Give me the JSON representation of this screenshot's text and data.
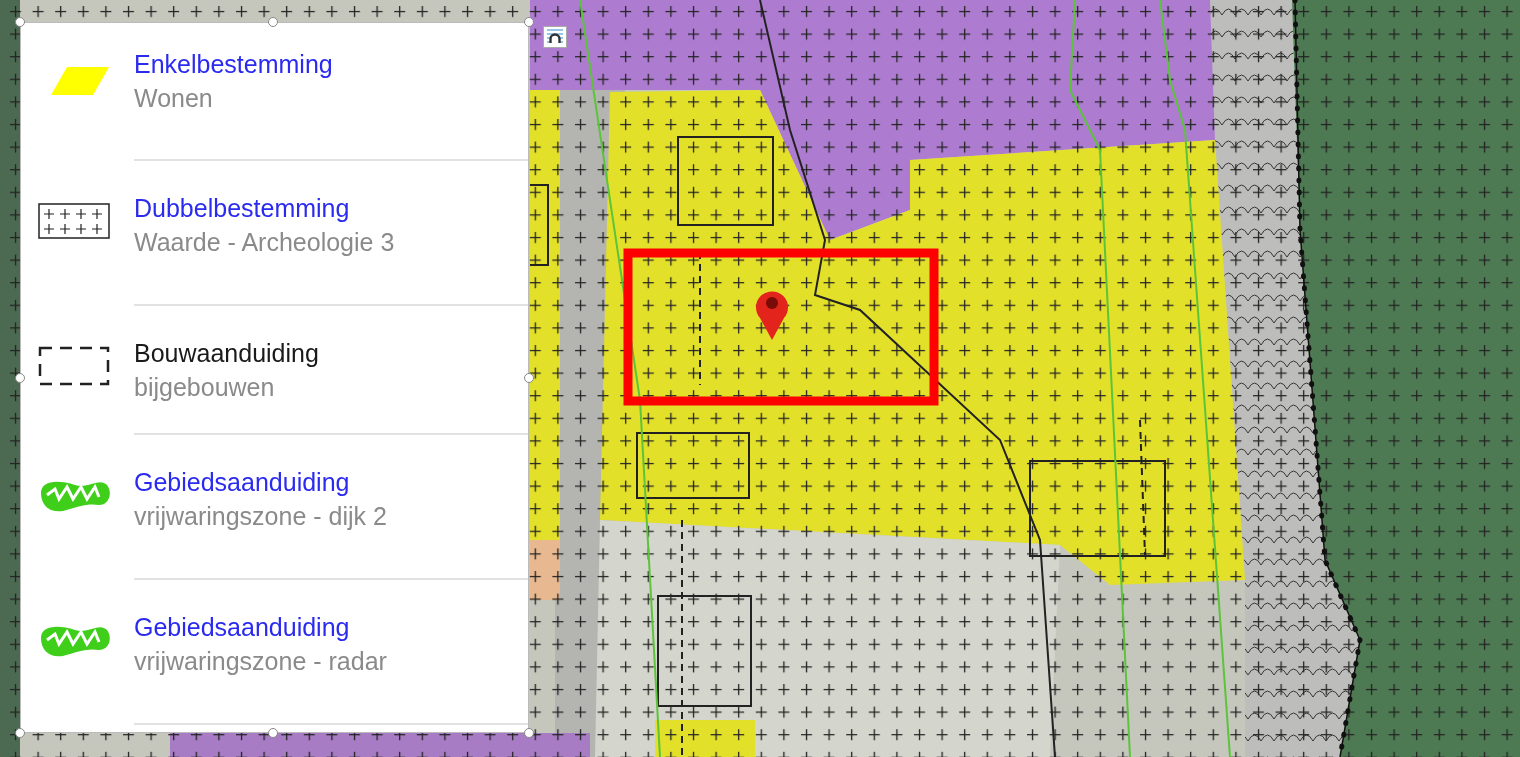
{
  "legend": {
    "items": [
      {
        "kind": "fill",
        "title": "Enkelbestemming",
        "subtitle": "Wonen",
        "link": true
      },
      {
        "kind": "pattern",
        "title": "Dubbelbestemming",
        "subtitle": "Waarde - Archeologie 3",
        "link": true
      },
      {
        "kind": "dashed",
        "title": "Bouwaanduiding",
        "subtitle": "bijgebouwen",
        "link": false
      },
      {
        "kind": "zone",
        "title": "Gebiedsaanduiding",
        "subtitle": "vrijwaringszone - dijk 2",
        "link": true
      },
      {
        "kind": "zone",
        "title": "Gebiedsaanduiding",
        "subtitle": "vrijwaringszone - radar",
        "link": true
      }
    ]
  }
}
